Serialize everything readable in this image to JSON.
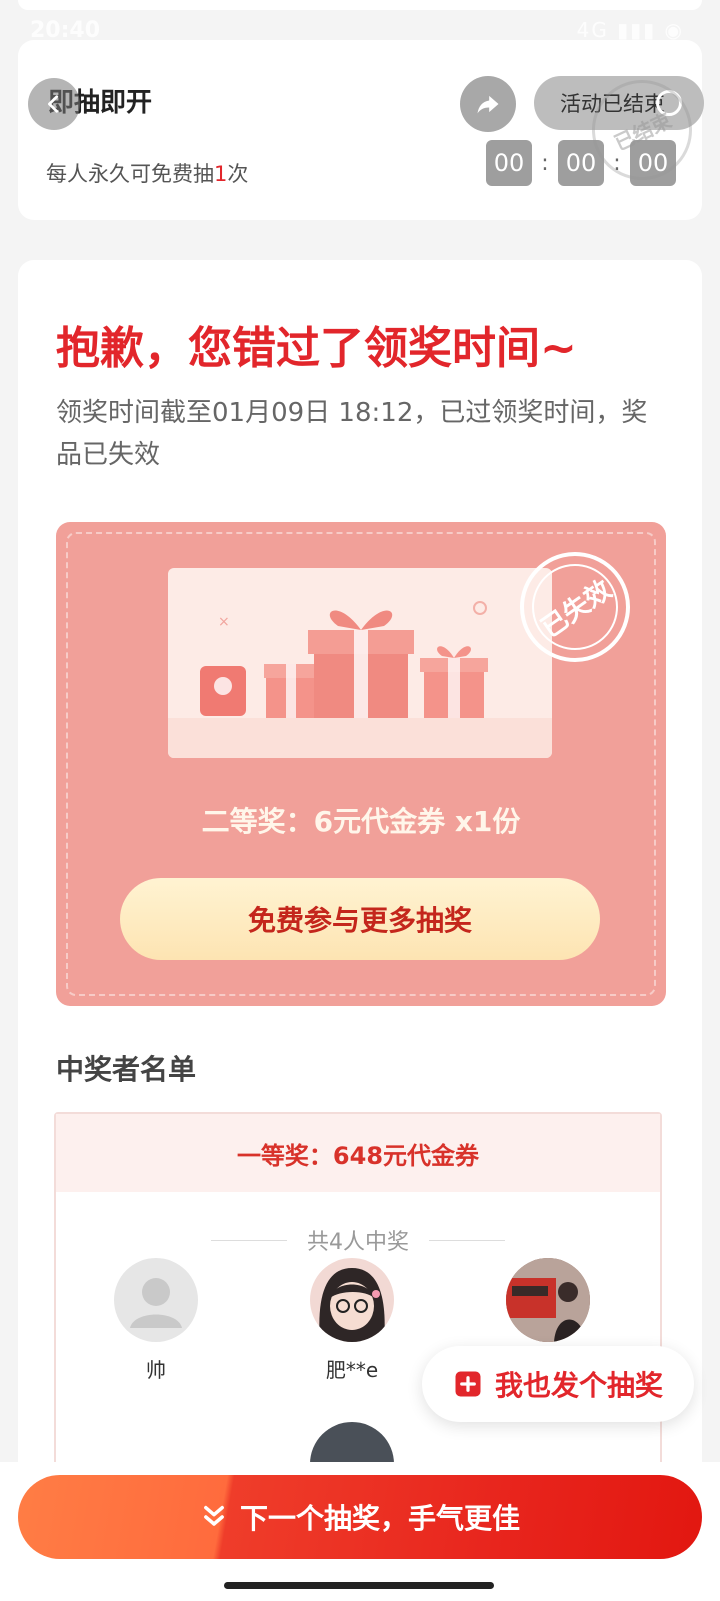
{
  "status": {
    "time": "20:40",
    "icons": "4G ▮▮▮ ◉"
  },
  "header": {
    "title": "即抽即开",
    "rule_prefix": "每人永久可免费抽",
    "rule_count": "1",
    "rule_suffix": "次",
    "ended_label": "活动已结束",
    "countdown": [
      "00",
      "00",
      "00"
    ],
    "countdown_sep": ":",
    "seal_text": "已结束"
  },
  "result": {
    "title": "抱歉，您错过了领奖时间~",
    "description": "领奖时间截至01月09日 18:12，已过领奖时间，奖品已失效"
  },
  "prize": {
    "stamp": "已失效",
    "name": "二等奖：6元代金券 x1份",
    "cta": "免费参与更多抽奖"
  },
  "winners": {
    "section_title": "中奖者名单",
    "tier": "一等奖：648元代金券",
    "count": "共4人中奖",
    "people": [
      {
        "name": "帅"
      },
      {
        "name": "肥**e"
      },
      {
        "name": ""
      }
    ]
  },
  "float_action": {
    "label": "我也发个抽奖"
  },
  "bottom": {
    "label": "下一个抽奖，手气更佳"
  },
  "colors": {
    "accent": "#e2262b",
    "prize_bg": "#f1a099",
    "cta_bg": "#fde4b2"
  },
  "icons": {
    "back": "chevron-left-icon",
    "share": "share-arrow-icon",
    "add": "plus-square-icon",
    "next": "double-chevron-down-icon"
  }
}
